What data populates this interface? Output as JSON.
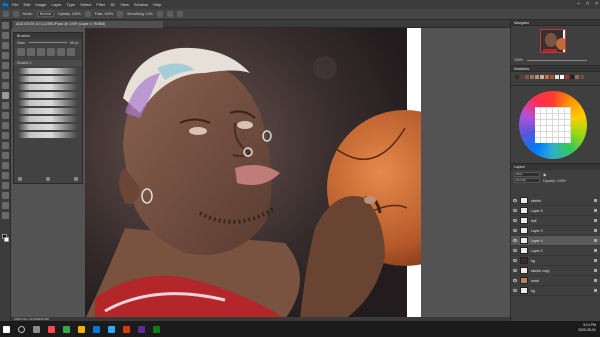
{
  "menubar": {
    "items": [
      "File",
      "Edit",
      "Image",
      "Layer",
      "Type",
      "Select",
      "Filter",
      "3D",
      "View",
      "Window",
      "Help"
    ]
  },
  "options": {
    "mode": "Normal",
    "opacity": "Opacity: 100%",
    "flow": "Flow: 100%",
    "smoothing": "Smoothing: 10%",
    "zoom": "100%"
  },
  "document": {
    "tab_title": "ADD ATION 10 CLOSEUP.psd @ 100% (Layer 4, RGB/8)",
    "status": "100%   Doc: 26.4M/220.4M"
  },
  "brushes_panel": {
    "title": "Brushes",
    "size_label": "Size:",
    "size_value": "59 px",
    "group_label": "Scratch 1"
  },
  "navigator": {
    "title": "Navigator",
    "zoom": "100%"
  },
  "swatches": {
    "title": "Swatches",
    "colors": [
      "#3a2a24",
      "#5a3f33",
      "#7a5a48",
      "#9a7460",
      "#b8907a",
      "#d2ac94",
      "#c96b3e",
      "#a85230",
      "#e0e0e0",
      "#ffffff",
      "#b03030",
      "#222222",
      "#8b6d5a",
      "#6f4e3d"
    ]
  },
  "layers": {
    "title": "Layers",
    "kind_label": "Kind",
    "blend": "Normal",
    "opacity_label": "Opacity: 100%",
    "lock_label": "Lock:",
    "fill_label": "Fill: 100%",
    "rows": [
      {
        "name": "sketch",
        "thumb": "light",
        "selected": false
      },
      {
        "name": "Layer 5",
        "thumb": "light",
        "selected": false
      },
      {
        "name": "ball",
        "thumb": "light",
        "selected": false
      },
      {
        "name": "Layer 3",
        "thumb": "light",
        "selected": false
      },
      {
        "name": "Layer 4",
        "thumb": "light",
        "selected": true
      },
      {
        "name": "Layer 2",
        "thumb": "light",
        "selected": false
      },
      {
        "name": "bg",
        "thumb": "dark",
        "selected": false
      },
      {
        "name": "sketch copy",
        "thumb": "light",
        "selected": false
      },
      {
        "name": "head",
        "thumb": "img",
        "selected": false
      },
      {
        "name": "bg",
        "thumb": "light",
        "selected": false
      }
    ]
  },
  "taskbar": {
    "time": "3:14 PM",
    "date": "2020-05-01"
  },
  "icons": [
    "photoshop-logo",
    "brush-tool-icon",
    "eye-icon",
    "windows-start-icon",
    "search-icon"
  ]
}
